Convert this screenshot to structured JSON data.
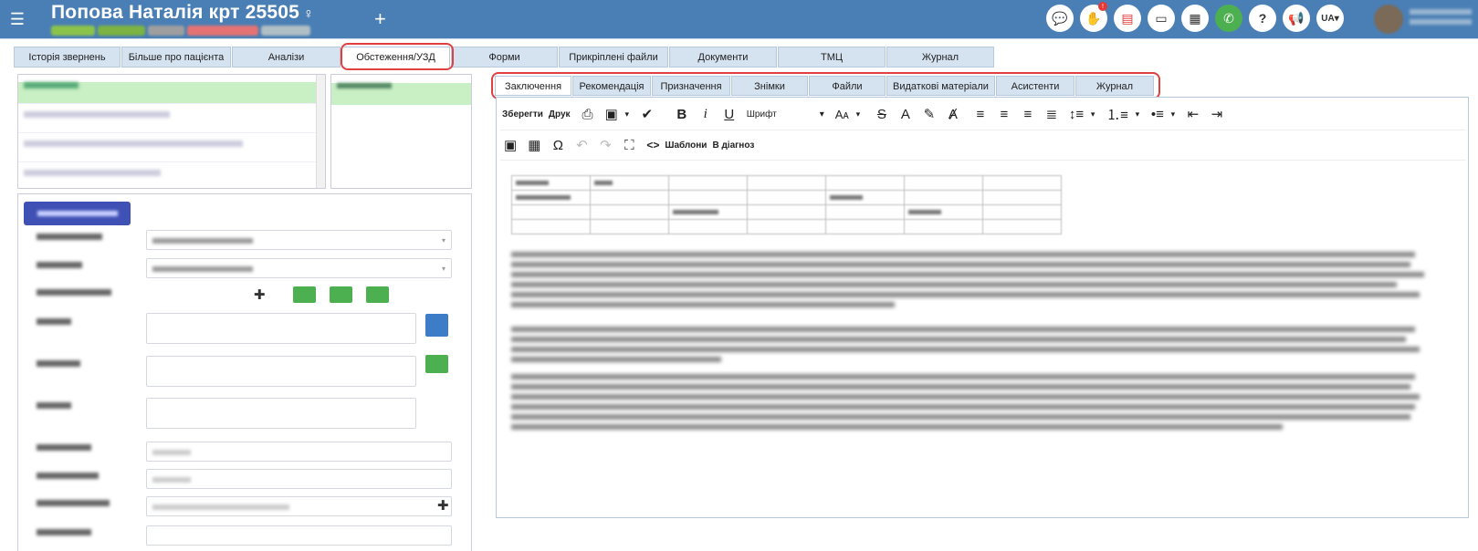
{
  "header": {
    "menu_icon": "hamburger-icon",
    "patient_title": "Попова Наталія крт 25505",
    "gender_symbol": "♀",
    "add_symbol": "+",
    "lang": "UA",
    "icons": [
      "chat-icon",
      "hand-icon",
      "pdf-icon",
      "card-icon",
      "calculator-icon",
      "phone-icon",
      "help-icon",
      "megaphone-icon"
    ]
  },
  "main_tabs": [
    "Історія звернень",
    "Більше про пацієнта",
    "Аналізи",
    "Обстеження/УЗД",
    "Форми",
    "Прикріплені файли",
    "Документи",
    "ТМЦ",
    "Журнал"
  ],
  "inner_tabs": [
    "Заключення",
    "Рекомендація",
    "Призначення",
    "Знімки",
    "Файли",
    "Видаткові матеріали",
    "Асистенти",
    "Журнал"
  ],
  "toolbar": {
    "save_label": "Зберегти",
    "print_label": "Друк",
    "font_label": "Шрифт",
    "templates_label": "Шаблони",
    "to_diagnosis_label": "В діагноз"
  },
  "colors": {
    "header_bg": "#4a7fb5",
    "tab_bg": "#d5e2f0",
    "highlight": "#e04040",
    "selected_row": "#c9efc4",
    "doctor_button": "#3f51b5",
    "green_button": "#4caf50"
  }
}
